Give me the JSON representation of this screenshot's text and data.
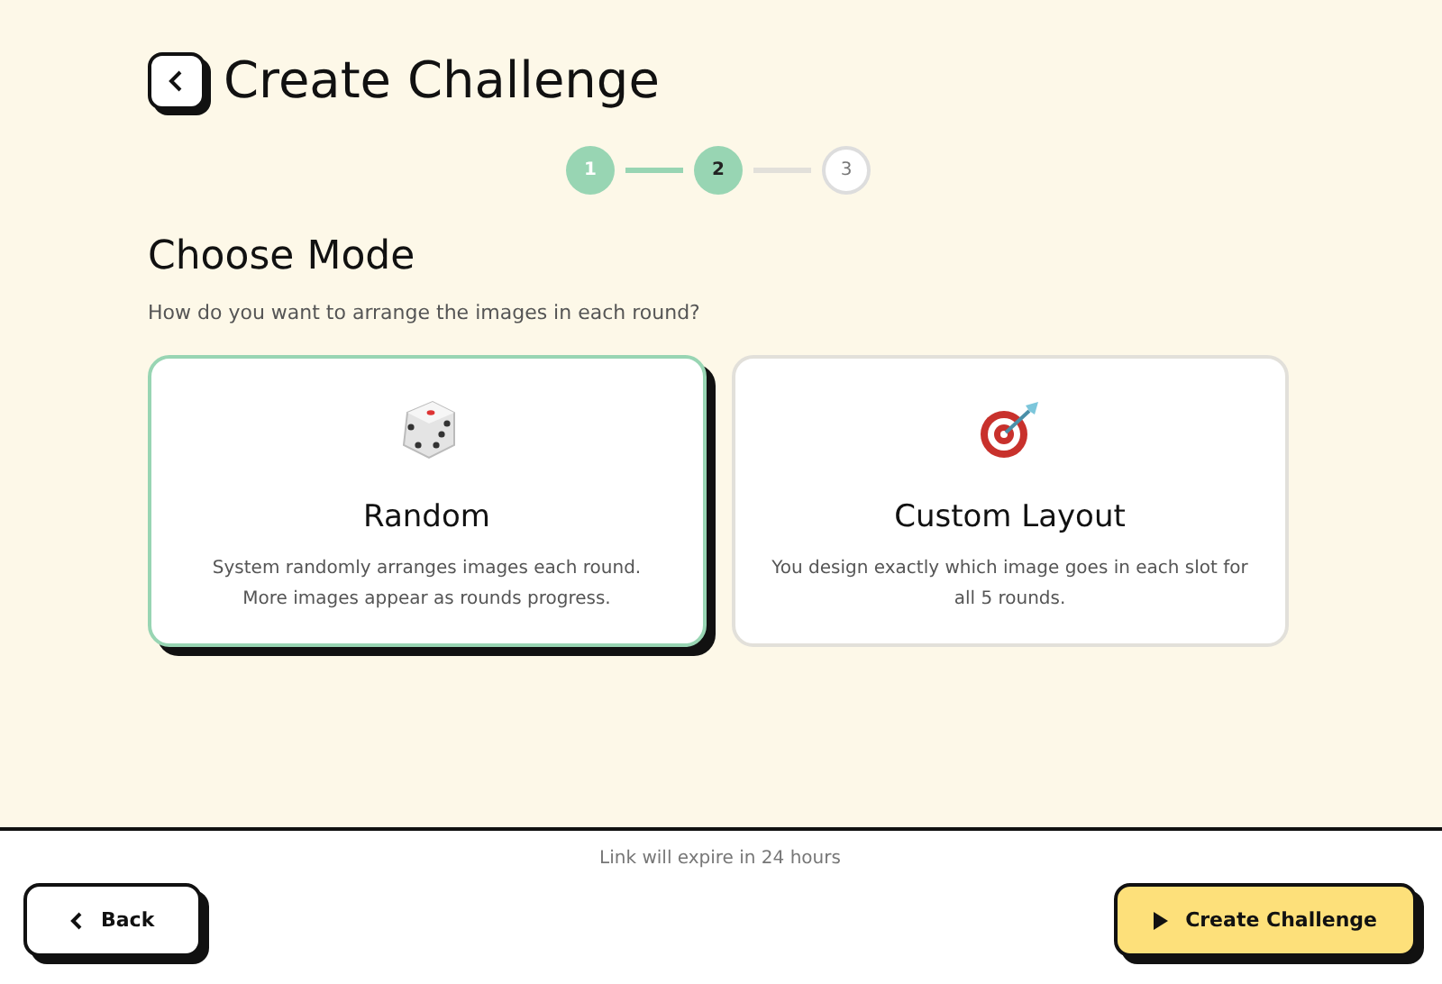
{
  "header": {
    "title": "Create Challenge"
  },
  "steps": [
    {
      "label": "1",
      "kind": "done"
    },
    {
      "label": "2",
      "kind": "current"
    },
    {
      "label": "3",
      "kind": "todo"
    }
  ],
  "section": {
    "title": "Choose Mode",
    "subtitle": "How do you want to arrange the images in each round?"
  },
  "modes": [
    {
      "kind": "die",
      "title": "Random",
      "description": "System randomly arranges images each round. More images appear as rounds progress.",
      "selected": true
    },
    {
      "kind": "target",
      "title": "Custom Layout",
      "description": "You design exactly which image goes in each slot for all 5 rounds.",
      "selected": false
    }
  ],
  "footer": {
    "note": "Link will expire in 24 hours",
    "back_label": "Back",
    "create_label": "Create Challenge"
  }
}
